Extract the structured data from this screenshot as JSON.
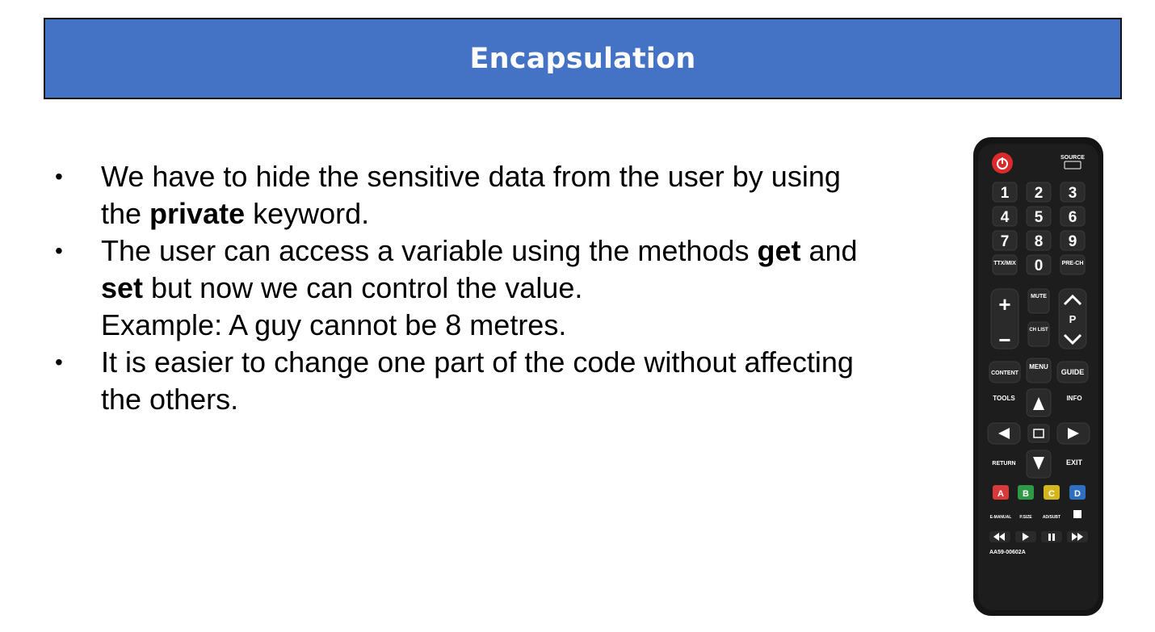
{
  "title": "Encapsulation",
  "bullets": [
    {
      "marker": "•",
      "segments": [
        {
          "text": "We have to hide the sensitive data from the user by using the ",
          "bold": false
        },
        {
          "text": "private",
          "bold": true
        },
        {
          "text": " keyword.",
          "bold": false
        }
      ]
    },
    {
      "marker": "•",
      "segments": [
        {
          "text": "The user can access a variable using the methods ",
          "bold": false
        },
        {
          "text": "get",
          "bold": true
        },
        {
          "text": " and ",
          "bold": false
        },
        {
          "text": "set",
          "bold": true
        },
        {
          "text": " but now we can control the value.",
          "bold": false
        },
        {
          "text": "Example: A guy cannot be 8 metres.",
          "bold": false,
          "newline": true
        }
      ]
    },
    {
      "marker": "•",
      "segments": [
        {
          "text": "It is easier to change one part of the code without affecting the others.",
          "bold": false
        }
      ]
    }
  ],
  "remote": {
    "source": "SOURCE",
    "digits": [
      "1",
      "2",
      "3",
      "4",
      "5",
      "6",
      "7",
      "8",
      "9",
      "0"
    ],
    "ttx": "TTX/MIX",
    "prech": "PRE-CH",
    "mute": "MUTE",
    "chlist": "CH LIST",
    "p": "P",
    "content": "CONTENT",
    "menu": "MENU",
    "guide": "GUIDE",
    "tools": "TOOLS",
    "info": "INFO",
    "return": "RETURN",
    "exit": "EXIT",
    "color_keys": [
      "A",
      "B",
      "C",
      "D"
    ],
    "color_key_colors": [
      "#d83a3a",
      "#2f9a45",
      "#d6b61e",
      "#2f6fc0"
    ],
    "power_color": "#d92b2b",
    "emanual": "E-MANUAL",
    "psize": "P.SIZE",
    "adsubt": "AD/SUBT",
    "model": "AA59-00602A"
  }
}
